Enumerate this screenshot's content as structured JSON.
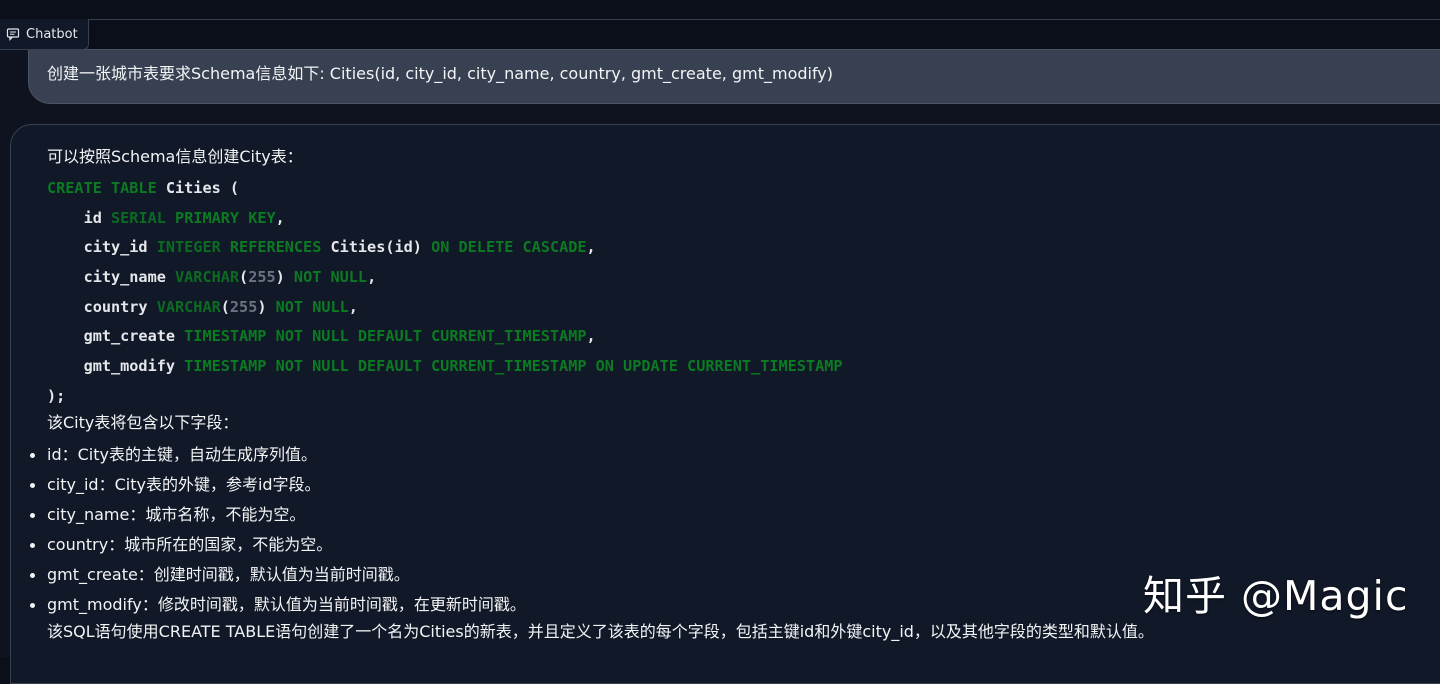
{
  "chatbot": {
    "label": "Chatbot",
    "icon": "chat-bubble-icon"
  },
  "user_message": "创建一张城市表要求Schema信息如下: Cities(id, city_id, city_name, country, gmt_create, gmt_modify)",
  "bot": {
    "intro": "可以按照Schema信息创建City表：",
    "code_lines": [
      [
        {
          "t": "CREATE TABLE",
          "c": "kw"
        },
        {
          "t": " Cities (",
          "c": ""
        }
      ],
      [
        {
          "t": "    id ",
          "c": ""
        },
        {
          "t": "SERIAL",
          "c": "ty"
        },
        {
          "t": " ",
          "c": ""
        },
        {
          "t": "PRIMARY KEY",
          "c": "kw"
        },
        {
          "t": ",",
          "c": ""
        }
      ],
      [
        {
          "t": "    city_id ",
          "c": ""
        },
        {
          "t": "INTEGER",
          "c": "ty"
        },
        {
          "t": " ",
          "c": ""
        },
        {
          "t": "REFERENCES",
          "c": "kw"
        },
        {
          "t": " Cities(id) ",
          "c": ""
        },
        {
          "t": "ON DELETE CASCADE",
          "c": "kw"
        },
        {
          "t": ",",
          "c": ""
        }
      ],
      [
        {
          "t": "    city_name ",
          "c": ""
        },
        {
          "t": "VARCHAR",
          "c": "ty"
        },
        {
          "t": "(",
          "c": ""
        },
        {
          "t": "255",
          "c": "num"
        },
        {
          "t": ") ",
          "c": ""
        },
        {
          "t": "NOT NULL",
          "c": "kw"
        },
        {
          "t": ",",
          "c": ""
        }
      ],
      [
        {
          "t": "    country ",
          "c": ""
        },
        {
          "t": "VARCHAR",
          "c": "ty"
        },
        {
          "t": "(",
          "c": ""
        },
        {
          "t": "255",
          "c": "num"
        },
        {
          "t": ") ",
          "c": ""
        },
        {
          "t": "NOT NULL",
          "c": "kw"
        },
        {
          "t": ",",
          "c": ""
        }
      ],
      [
        {
          "t": "    gmt_create ",
          "c": ""
        },
        {
          "t": "TIMESTAMP NOT NULL DEFAULT CURRENT_TIMESTAMP",
          "c": "kw"
        },
        {
          "t": ",",
          "c": ""
        }
      ],
      [
        {
          "t": "    gmt_modify ",
          "c": ""
        },
        {
          "t": "TIMESTAMP NOT NULL DEFAULT CURRENT_TIMESTAMP ON UPDATE CURRENT_TIMESTAMP",
          "c": "kw"
        }
      ],
      [
        {
          "t": ");",
          "c": ""
        }
      ]
    ],
    "fields_intro": "该City表将包含以下字段：",
    "fields": [
      "id：City表的主键，自动生成序列值。",
      "city_id：City表的外键，参考id字段。",
      "city_name：城市名称，不能为空。",
      "country：城市所在的国家，不能为空。",
      "gmt_create：创建时间戳，默认值为当前时间戳。",
      "gmt_modify：修改时间戳，默认值为当前时间戳，在更新时间戳。"
    ],
    "conclusion": "该SQL语句使用CREATE TABLE语句创建了一个名为Cities的新表，并且定义了该表的每个字段，包括主键id和外键city_id，以及其他字段的类型和默认值。"
  },
  "watermark": "知乎 @Magic",
  "colors": {
    "background": "#0b0f19",
    "user_bubble": "#374151",
    "bot_bubble": "#111827",
    "keyword_green": "#0b7a23",
    "number_gray": "#6b7280"
  }
}
